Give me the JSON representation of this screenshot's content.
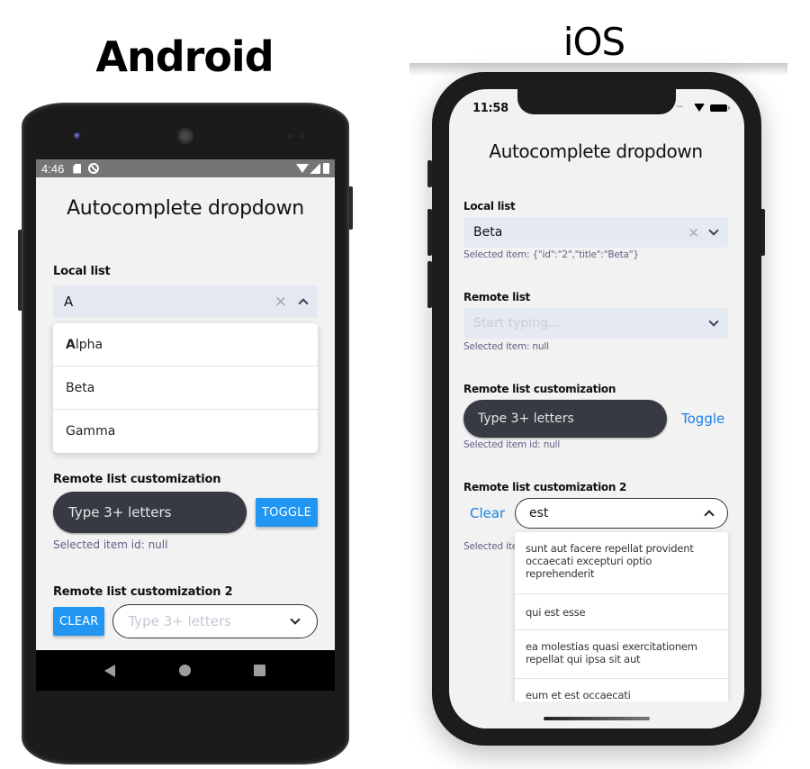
{
  "titles": {
    "android": "Android",
    "ios": "iOS"
  },
  "android": {
    "status_bar": {
      "time": "4:46",
      "icons": [
        "sd-card-icon",
        "sync-icon",
        "wifi-icon",
        "signal-icon",
        "battery-icon"
      ]
    },
    "heading": "Autocomplete dropdown",
    "local_list": {
      "label": "Local list",
      "value": "A",
      "clear_icon": "×",
      "options": [
        {
          "match": "A",
          "rest": "lpha"
        },
        {
          "match": "",
          "rest": "Beta"
        },
        {
          "match": "",
          "rest": "Gamma"
        }
      ]
    },
    "remote_custom": {
      "label": "Remote list customization",
      "placeholder": "Type 3+ letters",
      "toggle_label": "TOGGLE",
      "selected": "Selected item id: null"
    },
    "remote_custom2": {
      "label": "Remote list customization 2",
      "clear_label": "CLEAR",
      "placeholder": "Type 3+ letters"
    },
    "accent": "#2196f3"
  },
  "ios": {
    "status_bar": {
      "time": "11:58",
      "dots": "....."
    },
    "heading": "Autocomplete dropdown",
    "local_list": {
      "label": "Local list",
      "value": "Beta",
      "clear_icon": "×",
      "selected": "Selected item: {\"id\":\"2\",\"title\":\"Beta\"}"
    },
    "remote_list": {
      "label": "Remote list",
      "placeholder": "Start typing...",
      "selected": "Selected item: null"
    },
    "remote_custom": {
      "label": "Remote list customization",
      "placeholder": "Type 3+ letters",
      "toggle_label": "Toggle",
      "selected": "Selected item id: null"
    },
    "remote_custom2": {
      "label": "Remote list customization 2",
      "clear_label": "Clear",
      "value": "est",
      "selected_partial": "Selected ite",
      "options": [
        "sunt aut facere repellat provident occaecati excepturi optio reprehenderit",
        "qui est esse",
        "ea molestias quasi exercitationem repellat qui ipsa sit aut",
        "eum et est occaecati"
      ]
    },
    "accent": "#1a82e6"
  }
}
